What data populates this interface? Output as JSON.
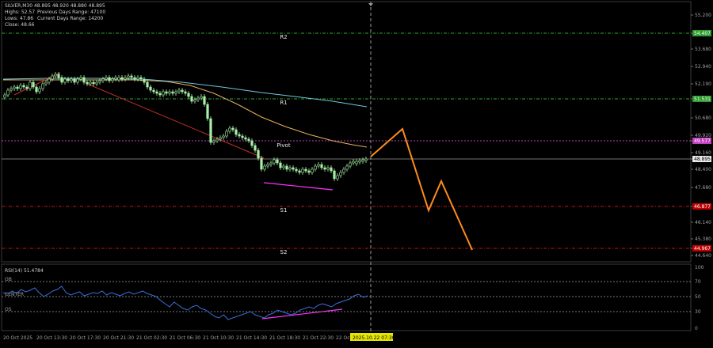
{
  "header": {
    "symbol": "SILVER,M30  48.895 48.920 48.880 48.895",
    "line2a": "Highs: 52.57",
    "line2b": "Previous Days Range:  47100",
    "line3a": "Lows: 47.86",
    "line3b": "Current Days Range:  14200",
    "line4": "Close: 48.66"
  },
  "levels": {
    "r2": "R2",
    "r1": "R1",
    "pivot": "Pivot",
    "s1": "S1",
    "s2": "S2"
  },
  "price_axis": {
    "ticks": [
      "55.200",
      "54.407",
      "53.680",
      "52.940",
      "52.190",
      "51.531",
      "50.680",
      "49.920",
      "49.577",
      "49.160",
      "48.895",
      "48.400",
      "47.680",
      "46.877",
      "46.140",
      "45.380",
      "44.967",
      "44.640"
    ],
    "badges": [
      {
        "label": "54.407",
        "color": "#2e9c2e"
      },
      {
        "label": "51.531",
        "color": "#2e9c2e"
      },
      {
        "label": "49.577",
        "color": "#c040c0"
      },
      {
        "label": "48.895",
        "color": "#e8e8e8"
      },
      {
        "label": "46.877",
        "color": "#c00000"
      },
      {
        "label": "44.967",
        "color": "#c00000"
      }
    ]
  },
  "rsi": {
    "title": "RSI(14) 51.4784",
    "ob": "OB",
    "center": "CENTER",
    "os": "OS",
    "ticks": [
      "100",
      "70",
      "50",
      "30",
      "0"
    ]
  },
  "time_axis": {
    "labels": [
      "20 Oct 2025",
      "20 Oct 13:30",
      "20 Oct 17:30",
      "20 Oct 21:30",
      "21 Oct 02:30",
      "21 Oct 06:30",
      "21 Oct 10:30",
      "21 Oct 14:30",
      "21 Oct 18:30",
      "21 Oct 22:30",
      "22 Oct"
    ],
    "crosshair": "2025.10.22 07:30"
  },
  "colors": {
    "grid": "#2a2a2a",
    "bull": "#a8f0a8",
    "projection": "#ff8c1a",
    "divergence": "#ff33ff",
    "ma_fast": "#e8b060",
    "ma_slow": "#6fc7d9",
    "trendline": "#c0302a"
  }
}
